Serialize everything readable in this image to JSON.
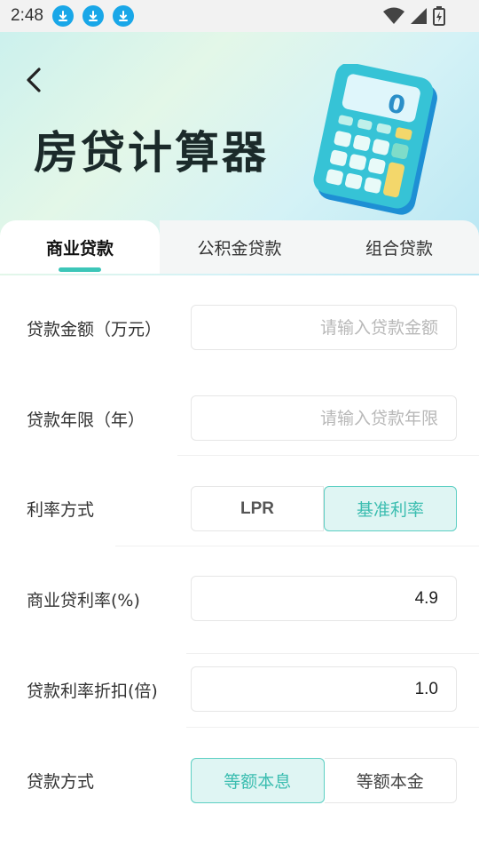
{
  "status_bar": {
    "time": "2:48",
    "download_icons": [
      "download-icon",
      "download-icon",
      "download-icon"
    ],
    "right_icons": [
      "wifi-icon",
      "signal-icon",
      "battery-icon"
    ]
  },
  "header": {
    "title": "房贷计算器",
    "back_icon": "chevron-left-icon",
    "illustration": "calculator-illustration",
    "calculator_display": "0"
  },
  "tabs": [
    {
      "label": "商业贷款",
      "active": true
    },
    {
      "label": "公积金贷款",
      "active": false
    },
    {
      "label": "组合贷款",
      "active": false
    }
  ],
  "form": {
    "loan_amount": {
      "label": "贷款金额（万元）",
      "placeholder": "请输入贷款金额",
      "value": ""
    },
    "loan_years": {
      "label": "贷款年限（年）",
      "placeholder": "请输入贷款年限",
      "value": ""
    },
    "rate_method": {
      "label": "利率方式",
      "options": [
        "LPR",
        "基准利率"
      ],
      "selected": "基准利率"
    },
    "commercial_rate": {
      "label": "商业贷利率(%)",
      "value": "4.9"
    },
    "rate_discount": {
      "label": "贷款利率折扣(倍)",
      "value": "1.0"
    },
    "repay_method": {
      "label": "贷款方式",
      "options": [
        "等额本息",
        "等额本金"
      ],
      "selected": "等额本息"
    }
  },
  "colors": {
    "accent": "#3cc6b8",
    "active_bg": "#dff5f3",
    "header_gradient_start": "#c9f0ee",
    "header_gradient_end": "#b8e6f3"
  }
}
